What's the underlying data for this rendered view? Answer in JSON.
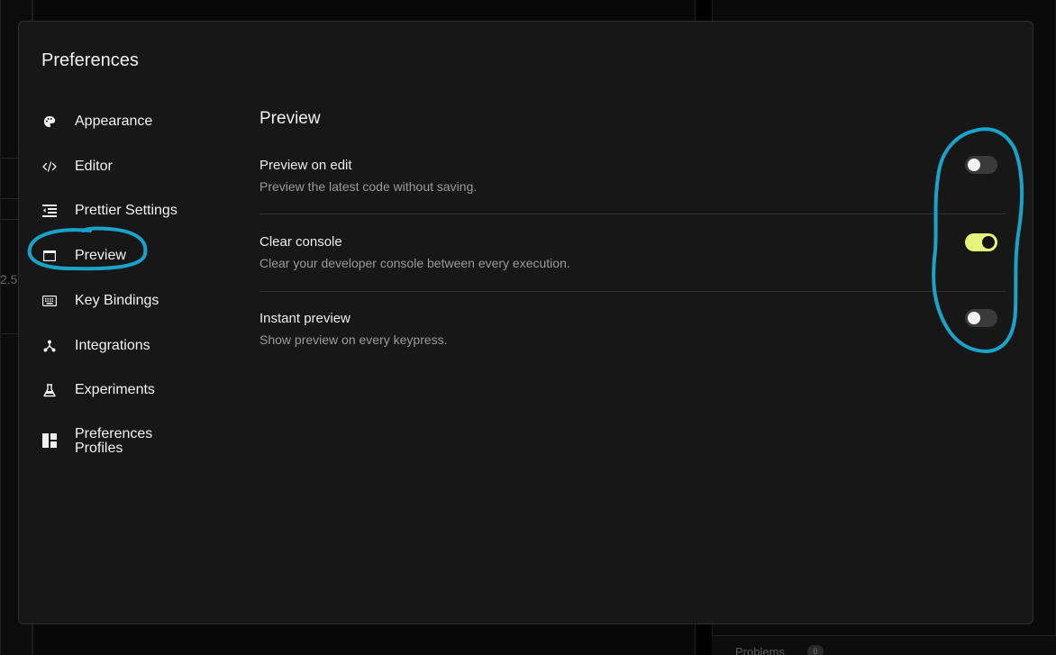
{
  "modal": {
    "title": "Preferences"
  },
  "sidebar": {
    "items": [
      {
        "label": "Appearance",
        "icon": "palette-icon"
      },
      {
        "label": "Editor",
        "icon": "code-icon"
      },
      {
        "label": "Prettier Settings",
        "icon": "format-indent-icon"
      },
      {
        "label": "Preview",
        "icon": "window-icon",
        "active": true
      },
      {
        "label": "Key Bindings",
        "icon": "keyboard-icon"
      },
      {
        "label": "Integrations",
        "icon": "network-icon"
      },
      {
        "label": "Experiments",
        "icon": "flask-icon"
      },
      {
        "label": "Preferences Profiles",
        "icon": "layout-icon"
      }
    ]
  },
  "preview": {
    "title": "Preview",
    "settings": [
      {
        "label": "Preview on edit",
        "description": "Preview the latest code without saving.",
        "enabled": false
      },
      {
        "label": "Clear console",
        "description": "Clear your developer console between every execution.",
        "enabled": true
      },
      {
        "label": "Instant preview",
        "description": "Show preview on every keypress.",
        "enabled": false
      }
    ]
  },
  "background": {
    "partial_number": "2.5",
    "problems_label": "Problems",
    "problems_count": "0"
  },
  "colors": {
    "accent_toggle": "#e6f57a",
    "annotation": "#1aa3c9",
    "modal_bg": "#171717"
  }
}
